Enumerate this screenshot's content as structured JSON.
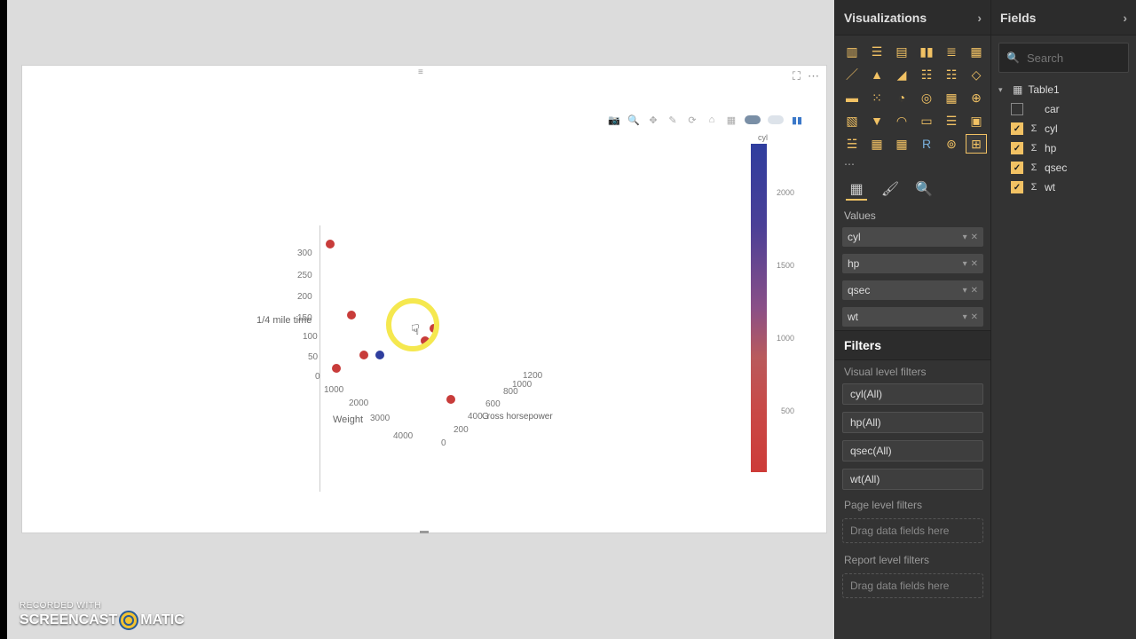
{
  "chart_data": {
    "type": "scatter",
    "dimensionality": "3d",
    "x_field": "hp",
    "y_field": "wt",
    "z_field": "qsec",
    "color_field": "cyl",
    "axes": {
      "y": {
        "label": "1/4 mile time",
        "ticks": [
          0,
          50,
          100,
          150,
          200,
          250,
          300
        ]
      },
      "x_front": {
        "label": "Weight",
        "ticks": [
          1000,
          2000,
          3000,
          4000
        ]
      },
      "x_side": {
        "label": "Gross horsepower",
        "ticks": [
          0,
          200,
          400,
          600,
          800,
          1000,
          1200
        ]
      }
    },
    "colorbar": {
      "title": "cyl",
      "ticks": [
        500,
        1000,
        1500,
        2000
      ]
    },
    "points_visible_approx": 8
  },
  "panels": {
    "visualizations": {
      "title": "Visualizations",
      "values_label": "Values",
      "wells": [
        "cyl",
        "hp",
        "qsec",
        "wt"
      ],
      "filters": {
        "title": "Filters",
        "visual_level_label": "Visual level filters",
        "visual_level": [
          "cyl(All)",
          "hp(All)",
          "qsec(All)",
          "wt(All)"
        ],
        "page_level_label": "Page level filters",
        "page_level_hint": "Drag data fields here",
        "report_level_label": "Report level filters",
        "report_level_hint": "Drag data fields here"
      }
    },
    "fields": {
      "title": "Fields",
      "search_placeholder": "Search",
      "table": "Table1",
      "columns": [
        {
          "name": "car",
          "checked": false,
          "aggregate": false
        },
        {
          "name": "cyl",
          "checked": true,
          "aggregate": true
        },
        {
          "name": "hp",
          "checked": true,
          "aggregate": true
        },
        {
          "name": "qsec",
          "checked": true,
          "aggregate": true
        },
        {
          "name": "wt",
          "checked": true,
          "aggregate": true
        }
      ]
    }
  },
  "plotly_toolbar": [
    "camera",
    "zoom",
    "pan",
    "orbit",
    "turntable",
    "reset-scale",
    "box-select",
    "view-a",
    "view-b",
    "logo"
  ],
  "watermark": {
    "line1": "RECORDED WITH",
    "brand_a": "SCREENCAST",
    "brand_b": "MATIC"
  }
}
